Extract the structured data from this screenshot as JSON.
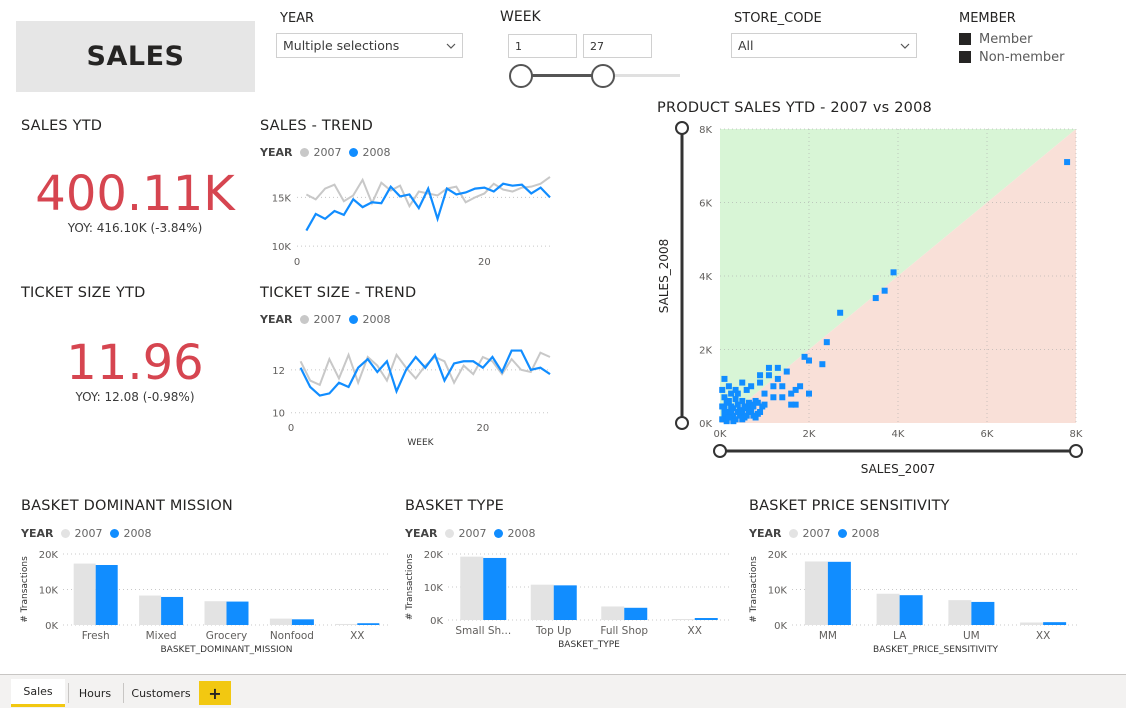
{
  "page_title": "SALES",
  "colors": {
    "c2007": "#c8c8c8",
    "c2008": "#118dff",
    "kpi": "#d64550",
    "bar2007": "#e3e3e3",
    "green_region": "#d8f5d6",
    "red_region": "#f9e0d8"
  },
  "slicers": {
    "year": {
      "label": "YEAR",
      "value": "Multiple selections"
    },
    "week": {
      "label": "WEEK",
      "from": "1",
      "to": "27"
    },
    "store": {
      "label": "STORE_CODE",
      "value": "All"
    },
    "member": {
      "label": "MEMBER",
      "options": [
        "Member",
        "Non-member"
      ]
    }
  },
  "kpis": {
    "sales": {
      "title": "SALES YTD",
      "value": "400.11K",
      "yoy": "YOY: 416.10K (-3.84%)"
    },
    "ticket": {
      "title": "TICKET SIZE YTD",
      "value": "11.96",
      "yoy": "YOY: 12.08 (-0.98%)"
    }
  },
  "legend": {
    "label": "YEAR",
    "y2007": "2007",
    "y2008": "2008"
  },
  "tabs": [
    "Sales",
    "Hours",
    "Customers"
  ],
  "add_tab": "+",
  "chart_data": [
    {
      "id": "sales_trend",
      "type": "line",
      "title": "SALES - TREND",
      "xlabel": "",
      "xlim": [
        0,
        27
      ],
      "ylim": [
        9500,
        17500
      ],
      "xticks": [
        0,
        20
      ],
      "yticks": [
        10000,
        15000
      ],
      "ytick_labels": [
        "10K",
        "15K"
      ],
      "x": [
        1,
        2,
        3,
        4,
        5,
        6,
        7,
        8,
        9,
        10,
        11,
        12,
        13,
        14,
        15,
        16,
        17,
        18,
        19,
        20,
        21,
        22,
        23,
        24,
        25,
        26,
        27
      ],
      "series": [
        {
          "name": "2007",
          "values": [
            15300,
            14800,
            15900,
            16300,
            14600,
            15200,
            16800,
            14400,
            16500,
            15700,
            16200,
            14100,
            15600,
            15400,
            15200,
            15900,
            16100,
            14500,
            15000,
            15400,
            16400,
            15800,
            15600,
            16000,
            16100,
            16400,
            17100
          ]
        },
        {
          "name": "2008",
          "values": [
            11600,
            13300,
            12800,
            13600,
            13200,
            14800,
            14000,
            14500,
            14400,
            16100,
            15100,
            15300,
            13900,
            15900,
            12800,
            15900,
            15300,
            15500,
            15900,
            16000,
            15600,
            16400,
            16200,
            16300,
            15400,
            16000,
            15000
          ]
        }
      ]
    },
    {
      "id": "ticket_trend",
      "type": "line",
      "title": "TICKET SIZE - TREND",
      "xlabel": "WEEK",
      "xlim": [
        0,
        27
      ],
      "ylim": [
        9.8,
        13.3
      ],
      "xticks": [
        0,
        20
      ],
      "yticks": [
        10,
        12
      ],
      "ytick_labels": [
        "10",
        "12"
      ],
      "x": [
        1,
        2,
        3,
        4,
        5,
        6,
        7,
        8,
        9,
        10,
        11,
        12,
        13,
        14,
        15,
        16,
        17,
        18,
        19,
        20,
        21,
        22,
        23,
        24,
        25,
        26,
        27
      ],
      "series": [
        {
          "name": "2007",
          "values": [
            12.4,
            11.5,
            11.3,
            12.5,
            11.6,
            12.7,
            11.4,
            12.6,
            12.2,
            11.5,
            12.7,
            12.1,
            11.6,
            12.2,
            12.6,
            12.4,
            11.4,
            12.2,
            11.8,
            12.6,
            12.4,
            11.8,
            12.5,
            12.0,
            11.9,
            12.8,
            12.6
          ]
        },
        {
          "name": "2008",
          "values": [
            12.1,
            11.2,
            10.8,
            10.9,
            11.4,
            11.2,
            12.1,
            12.5,
            11.9,
            12.4,
            11.0,
            12.0,
            12.6,
            12.1,
            12.7,
            11.5,
            12.3,
            12.4,
            12.4,
            12.1,
            12.6,
            11.9,
            12.9,
            12.9,
            12.0,
            12.1,
            11.8
          ]
        }
      ]
    },
    {
      "id": "product_scatter",
      "type": "scatter",
      "title": "PRODUCT SALES YTD - 2007 vs 2008",
      "xlabel": "SALES_2007",
      "ylabel": "SALES_2008",
      "xlim": [
        0,
        8000
      ],
      "ylim": [
        0,
        8000
      ],
      "xticks": [
        0,
        2000,
        4000,
        6000,
        8000
      ],
      "xtick_labels": [
        "0K",
        "2K",
        "4K",
        "6K",
        "8K"
      ],
      "yticks": [
        0,
        2000,
        4000,
        6000,
        8000
      ],
      "ytick_labels": [
        "0K",
        "2K",
        "4K",
        "6K",
        "8K"
      ],
      "points": [
        [
          7800,
          7100
        ],
        [
          3900,
          4100
        ],
        [
          3700,
          3600
        ],
        [
          3500,
          3400
        ],
        [
          2700,
          3000
        ],
        [
          2400,
          2200
        ],
        [
          2000,
          1700
        ],
        [
          2300,
          1600
        ],
        [
          2000,
          800
        ],
        [
          1700,
          500
        ],
        [
          1600,
          500
        ],
        [
          1400,
          1000
        ],
        [
          1500,
          1400
        ],
        [
          1900,
          1800
        ],
        [
          1800,
          1000
        ],
        [
          1300,
          1500
        ],
        [
          1100,
          1500
        ],
        [
          1200,
          1000
        ],
        [
          1000,
          800
        ],
        [
          1100,
          1300
        ],
        [
          1300,
          1200
        ],
        [
          900,
          1300
        ],
        [
          800,
          600
        ],
        [
          700,
          500
        ],
        [
          600,
          900
        ],
        [
          600,
          400
        ],
        [
          500,
          600
        ],
        [
          500,
          300
        ],
        [
          400,
          800
        ],
        [
          400,
          500
        ],
        [
          300,
          400
        ],
        [
          300,
          200
        ],
        [
          200,
          1000
        ],
        [
          200,
          600
        ],
        [
          200,
          300
        ],
        [
          100,
          1200
        ],
        [
          100,
          700
        ],
        [
          100,
          400
        ],
        [
          50,
          100
        ],
        [
          150,
          150
        ],
        [
          250,
          250
        ],
        [
          350,
          100
        ],
        [
          450,
          200
        ],
        [
          550,
          150
        ],
        [
          650,
          300
        ],
        [
          750,
          200
        ],
        [
          850,
          250
        ],
        [
          950,
          450
        ],
        [
          150,
          50
        ],
        [
          300,
          50
        ],
        [
          100,
          250
        ],
        [
          200,
          150
        ],
        [
          400,
          300
        ],
        [
          500,
          100
        ],
        [
          600,
          200
        ],
        [
          700,
          350
        ],
        [
          800,
          150
        ],
        [
          900,
          300
        ],
        [
          1000,
          500
        ],
        [
          1200,
          700
        ],
        [
          50,
          450
        ],
        [
          150,
          550
        ],
        [
          250,
          450
        ],
        [
          350,
          650
        ],
        [
          450,
          350
        ],
        [
          550,
          450
        ],
        [
          650,
          550
        ],
        [
          750,
          450
        ],
        [
          850,
          550
        ],
        [
          250,
          800
        ],
        [
          350,
          900
        ],
        [
          50,
          900
        ],
        [
          1400,
          700
        ],
        [
          1600,
          800
        ],
        [
          1700,
          900
        ],
        [
          500,
          1100
        ],
        [
          700,
          1000
        ],
        [
          900,
          1100
        ]
      ]
    },
    {
      "id": "basket_mission",
      "type": "bar",
      "title": "BASKET DOMINANT MISSION",
      "xlabel": "BASKET_DOMINANT_MISSION",
      "ylabel": "# Transactions",
      "ylim": [
        0,
        20000
      ],
      "yticks": [
        0,
        10000,
        20000
      ],
      "ytick_labels": [
        "0K",
        "10K",
        "20K"
      ],
      "categories": [
        "Fresh",
        "Mixed",
        "Grocery",
        "Nonfood",
        "XX"
      ],
      "series": [
        {
          "name": "2007",
          "values": [
            17300,
            8300,
            6700,
            1800,
            300
          ]
        },
        {
          "name": "2008",
          "values": [
            16900,
            7900,
            6600,
            1600,
            500
          ]
        }
      ]
    },
    {
      "id": "basket_type",
      "type": "bar",
      "title": "BASKET TYPE",
      "xlabel": "BASKET_TYPE",
      "ylabel": "# Transactions",
      "ylim": [
        0,
        20000
      ],
      "yticks": [
        0,
        10000,
        20000
      ],
      "ytick_labels": [
        "0K",
        "10K",
        "20K"
      ],
      "categories": [
        "Small Sh...",
        "Top Up",
        "Full Shop",
        "XX"
      ],
      "series": [
        {
          "name": "2007",
          "values": [
            19200,
            10700,
            4100,
            300
          ]
        },
        {
          "name": "2008",
          "values": [
            18800,
            10500,
            3700,
            600
          ]
        }
      ]
    },
    {
      "id": "basket_price",
      "type": "bar",
      "title": "BASKET PRICE SENSITIVITY",
      "xlabel": "BASKET_PRICE_SENSITIVITY",
      "ylabel": "# Transactions",
      "ylim": [
        0,
        20000
      ],
      "yticks": [
        0,
        10000,
        20000
      ],
      "ytick_labels": [
        "0K",
        "10K",
        "20K"
      ],
      "categories": [
        "MM",
        "LA",
        "UM",
        "XX"
      ],
      "series": [
        {
          "name": "2007",
          "values": [
            17900,
            8800,
            7000,
            700
          ]
        },
        {
          "name": "2008",
          "values": [
            17800,
            8400,
            6500,
            800
          ]
        }
      ]
    }
  ]
}
